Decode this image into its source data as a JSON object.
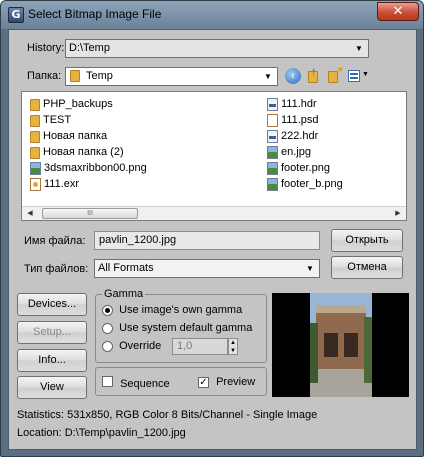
{
  "window": {
    "title": "Select Bitmap Image File",
    "close_glyph": "✕"
  },
  "history": {
    "label": "History:",
    "value": "D:\\Temp"
  },
  "folder": {
    "label": "Папка:",
    "value": "Temp"
  },
  "files_left": [
    {
      "name": "PHP_backups",
      "icon": "folder-icon"
    },
    {
      "name": "TEST",
      "icon": "folder-icon"
    },
    {
      "name": "Новая папка",
      "icon": "folder-icon"
    },
    {
      "name": "Новая папка (2)",
      "icon": "folder-icon"
    },
    {
      "name": "3dsmaxribbon00.png",
      "icon": "image-file-icon"
    },
    {
      "name": "111.exr",
      "icon": "exr-file-icon"
    }
  ],
  "files_right": [
    {
      "name": "111.hdr",
      "icon": "hdr-file-icon"
    },
    {
      "name": "111.psd",
      "icon": "psd-file-icon"
    },
    {
      "name": "222.hdr",
      "icon": "hdr-file-icon"
    },
    {
      "name": "en.jpg",
      "icon": "image-file-icon"
    },
    {
      "name": "footer.png",
      "icon": "image-file-icon"
    },
    {
      "name": "footer_b.png",
      "icon": "image-file-icon"
    }
  ],
  "filename": {
    "label": "Имя файла:",
    "value": "pavlin_1200.jpg"
  },
  "filetype": {
    "label": "Тип файлов:",
    "value": "All Formats"
  },
  "buttons": {
    "open": "Открыть",
    "cancel": "Отмена",
    "devices": "Devices...",
    "setup": "Setup...",
    "info": "Info...",
    "view": "View"
  },
  "gamma": {
    "title": "Gamma",
    "options": [
      "Use image's own gamma",
      "Use system default gamma",
      "Override"
    ],
    "selected": 0,
    "override_value": "1,0"
  },
  "options": {
    "sequence_label": "Sequence",
    "sequence_checked": false,
    "preview_label": "Preview",
    "preview_checked": true
  },
  "statistics": "Statistics:  531x850, RGB Color 8 Bits/Channel - Single Image",
  "location": "Location:  D:\\Temp\\pavlin_1200.jpg",
  "colors": {
    "title_bar": "#7f96ad",
    "close_button": "#c94f36",
    "dialog_bg": "#c4c4c4",
    "folder_yellow": "#e6b43c"
  }
}
